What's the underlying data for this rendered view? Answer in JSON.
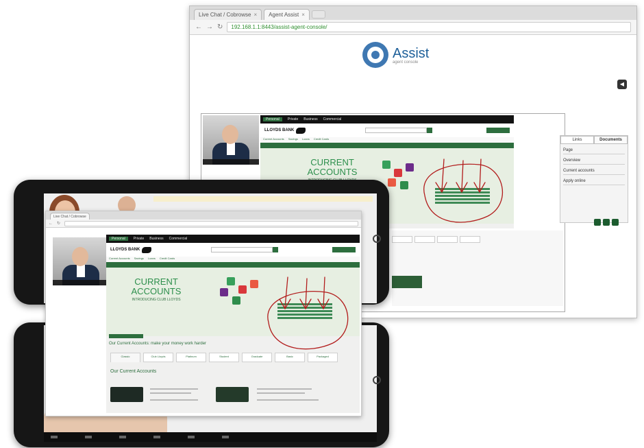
{
  "desktop_browser": {
    "tabs": [
      {
        "label": "Live Chat / Cobrowse"
      },
      {
        "label": "Agent Assist"
      },
      {
        "label": ""
      }
    ],
    "url": "192.168.1.1:8443/assist-agent-console/",
    "nav_back": "←",
    "nav_forward": "→",
    "nav_reload": "↻",
    "brand_name": "Assist",
    "brand_tagline": "agent console",
    "audio_icon": "speaker-icon"
  },
  "cobrowse": {
    "top_nav": [
      "Personal",
      "Private",
      "Business",
      "Commercial"
    ],
    "brand": "LLOYDS BANK",
    "hero_title": "CURRENT\nACCOUNTS",
    "hero_subtitle": "INTRODUCING CLUB LLOYDS",
    "subnav": [
      "Current Accounts",
      "Savings",
      "Loans",
      "Credit Cards"
    ]
  },
  "side_panel": {
    "tabs": [
      "Links",
      "Documents"
    ],
    "items": [
      "Page",
      "Overview",
      "Current accounts",
      "Apply online"
    ]
  },
  "front_browser": {
    "hero_title": "CURRENT\nACCOUNTS",
    "hero_subtitle": "INTRODUCING CLUB LLOYDS",
    "headline": "Our Current Accounts: make your money work harder",
    "section_title": "Our Current Accounts",
    "account_tabs": [
      "Classic",
      "Club Lloyds",
      "Platinum",
      "Student",
      "Graduate",
      "Basic",
      "Packaged"
    ]
  },
  "colors": {
    "brand_green": "#2d6e3e",
    "annotation_red": "#b21c1c"
  }
}
